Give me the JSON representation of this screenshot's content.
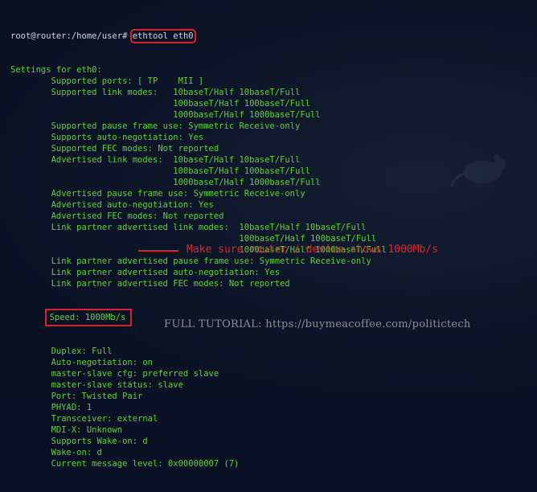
{
  "terminal": {
    "prompt": "root@router:/home/user#",
    "command": "ethtool eth0",
    "lines": [
      "Settings for eth0:",
      "        Supported ports: [ TP    MII ]",
      "        Supported link modes:   10baseT/Half 10baseT/Full",
      "                                100baseT/Half 100baseT/Full",
      "                                1000baseT/Half 1000baseT/Full",
      "        Supported pause frame use: Symmetric Receive-only",
      "        Supports auto-negotiation: Yes",
      "        Supported FEC modes: Not reported",
      "        Advertised link modes:  10baseT/Half 10baseT/Full",
      "                                100baseT/Half 100baseT/Full",
      "                                1000baseT/Half 1000baseT/Full",
      "        Advertised pause frame use: Symmetric Receive-only",
      "        Advertised auto-negotiation: Yes",
      "        Advertised FEC modes: Not reported",
      "        Link partner advertised link modes:  10baseT/Half 10baseT/Full",
      "                                             100baseT/Half 100baseT/Full",
      "                                             1000baseT/Half 1000baseT/Full",
      "        Link partner advertised pause frame use: Symmetric Receive-only",
      "        Link partner advertised auto-negotiation: Yes",
      "        Link partner advertised FEC modes: Not reported"
    ],
    "speed_indent": "        ",
    "speed_line": "Speed: 1000Mb/s",
    "lines_after": [
      "        Duplex: Full",
      "        Auto-negotiation: on",
      "        master-slave cfg: preferred slave",
      "        master-slave status: slave",
      "        Port: Twisted Pair",
      "        PHYAD: 1",
      "        Transceiver: external",
      "        MDI-X: Unknown",
      "        Supports Wake-on: d",
      "        Wake-on: d",
      "        Current message level: 0x00000007 (7)"
    ]
  },
  "annotation": {
    "callout": "Make sure router / device shows 1000Mb/s",
    "watermark": "FULL TUTORIAL: https://buymeacoffee.com/politictech"
  },
  "colors": {
    "terminal_text": "#5fd33a",
    "highlight": "#d8232a",
    "background": "#0b1124"
  }
}
